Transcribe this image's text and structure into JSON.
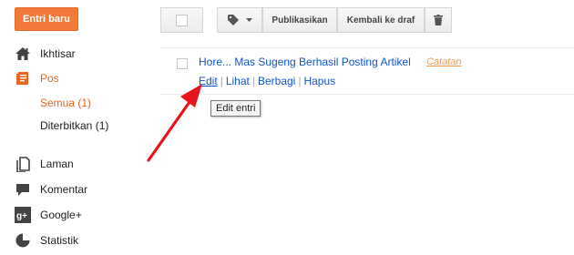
{
  "sidebar": {
    "new_entry_label": "Entri baru",
    "items": [
      {
        "label": "Ikhtisar",
        "icon": "home-icon"
      },
      {
        "label": "Pos",
        "icon": "posts-icon"
      },
      {
        "label": "Laman",
        "icon": "pages-icon"
      },
      {
        "label": "Komentar",
        "icon": "comment-icon"
      },
      {
        "label": "Google+",
        "icon": "google-plus-icon"
      },
      {
        "label": "Statistik",
        "icon": "stats-icon"
      }
    ],
    "sub_items": [
      {
        "label": "Semua (1)"
      },
      {
        "label": "Diterbitkan (1)"
      }
    ]
  },
  "toolbar": {
    "publish_label": "Publikasikan",
    "revert_label": "Kembali ke draf"
  },
  "post": {
    "title": "Hore... Mas Sugeng Berhasil Posting Artikel",
    "label": "Catatan",
    "actions": {
      "edit": "Edit",
      "view": "Lihat",
      "share": "Berbagi",
      "delete": "Hapus"
    },
    "tooltip": "Edit entri"
  },
  "colors": {
    "accent": "#f1793a",
    "link": "#1155cc",
    "label": "#f39a4f",
    "arrow": "#e8141c"
  }
}
